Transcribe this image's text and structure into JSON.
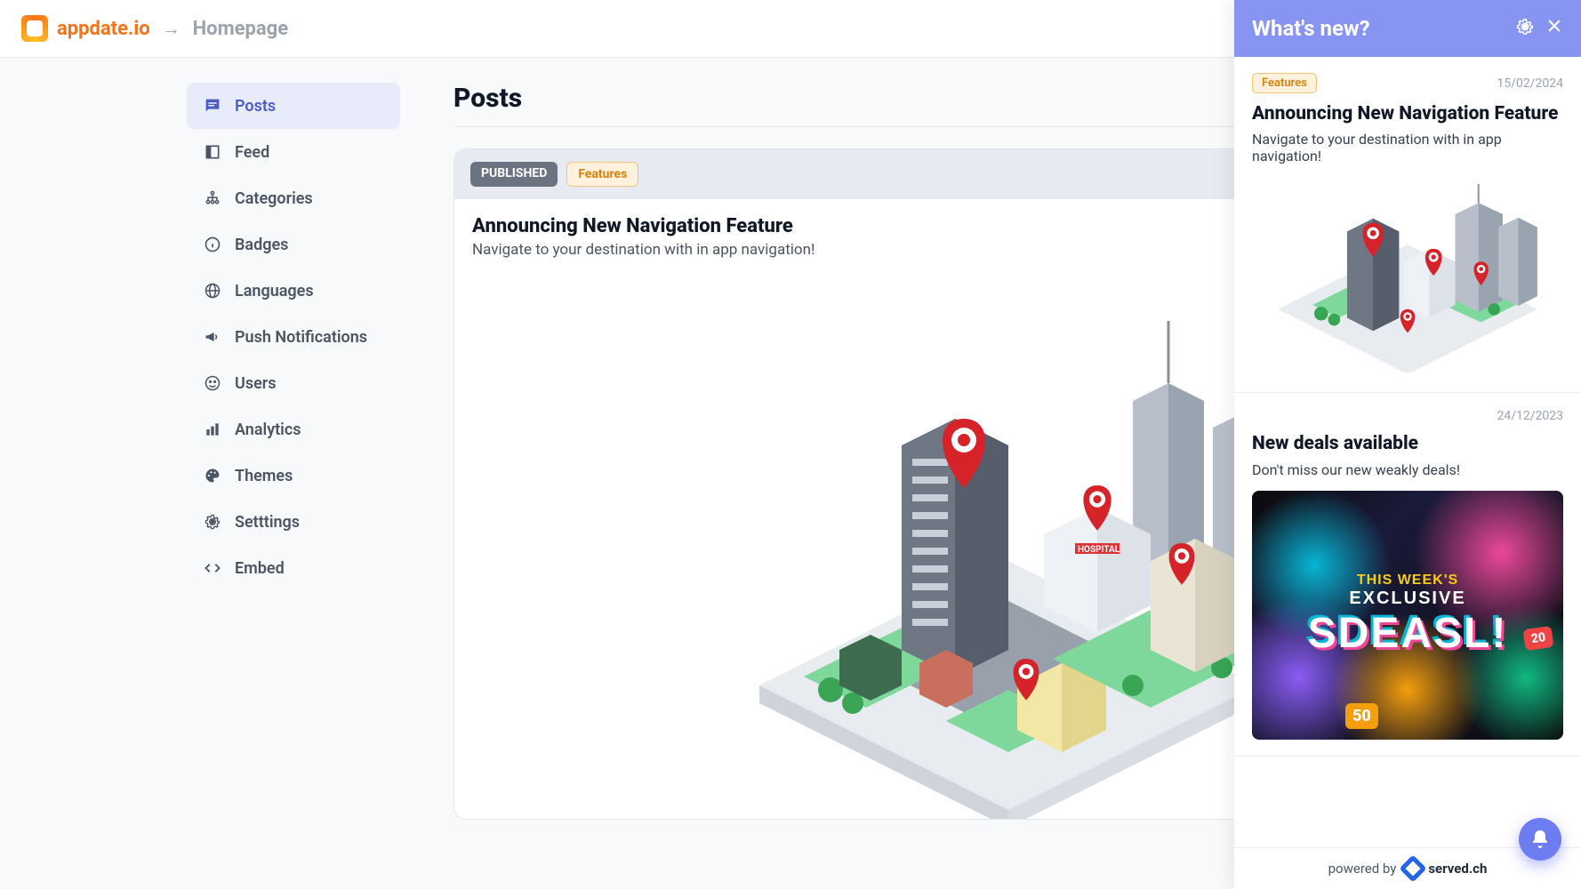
{
  "header": {
    "brand": "appdate.io",
    "breadcrumb": "Homepage"
  },
  "sidebar": {
    "items": [
      {
        "label": "Posts",
        "icon": "chat"
      },
      {
        "label": "Feed",
        "icon": "square"
      },
      {
        "label": "Categories",
        "icon": "tree"
      },
      {
        "label": "Badges",
        "icon": "info"
      },
      {
        "label": "Languages",
        "icon": "globe"
      },
      {
        "label": "Push Notifications",
        "icon": "megaphone"
      },
      {
        "label": "Users",
        "icon": "face"
      },
      {
        "label": "Analytics",
        "icon": "bars"
      },
      {
        "label": "Themes",
        "icon": "palette"
      },
      {
        "label": "Setttings",
        "icon": "gear"
      },
      {
        "label": "Embed",
        "icon": "code"
      }
    ]
  },
  "main": {
    "title": "Posts",
    "post": {
      "status": "PUBLISHED",
      "tag": "Features",
      "title": "Announcing New Navigation Feature",
      "desc": "Navigate to your destination with in app navigation!"
    }
  },
  "panel": {
    "title": "What's new?",
    "footer_prefix": "powered by",
    "footer_brand": "served.ch",
    "items": [
      {
        "tag": "Features",
        "date": "15/02/2024",
        "title": "Announcing New Navigation Feature",
        "desc": "Navigate to your destination with in app navigation!"
      },
      {
        "date": "24/12/2023",
        "title": "New deals available",
        "desc": "Don't miss our new weakly deals!",
        "deals": {
          "line1": "THIS WEEK'S",
          "line2": "EXCLUSIVE",
          "line3": "SDEASL!",
          "tag1": "50",
          "tag2": "20"
        }
      }
    ]
  }
}
